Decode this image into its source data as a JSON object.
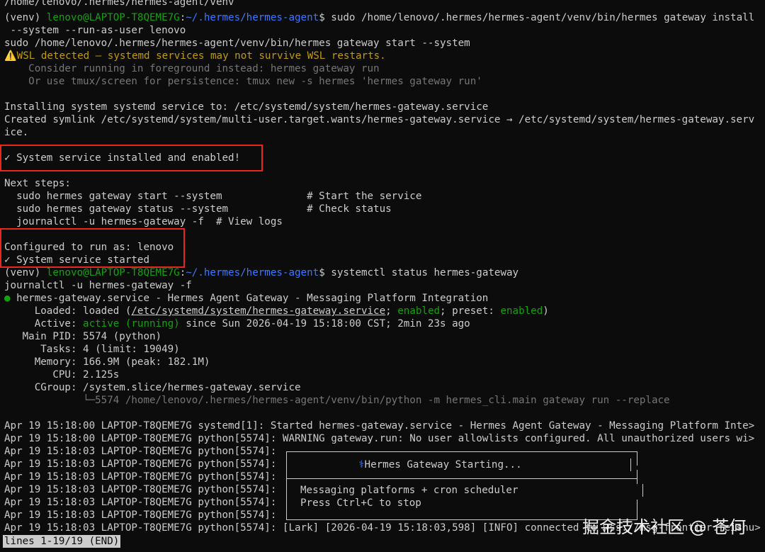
{
  "window": {
    "top_partial_line": "/home/lenovo/.hermes/hermes-agent/venv"
  },
  "prompt1": {
    "venv": "(venv) ",
    "userhost": "lenovo@LAPTOP-T8QEME7G",
    "sep": ":",
    "path": "~/.hermes/hermes-agent",
    "dollar": "$ ",
    "command": "sudo /home/lenovo/.hermes/hermes-agent/venv/bin/hermes gateway install",
    "command_wrap": " --system --run-as-user lenovo"
  },
  "install_output": {
    "sudo_echo": "sudo /home/lenovo/.hermes/hermes-agent/venv/bin/hermes gateway start --system",
    "wsl_warning_icon": "⚠️",
    "wsl_warning": "WSL detected — systemd services may not survive WSL restarts.",
    "hint1": "    Consider running in foreground instead: hermes gateway run",
    "hint2": "    Or use tmux/screen for persistence: tmux new -s hermes 'hermes gateway run'",
    "installing": "Installing system systemd service to: /etc/systemd/system/hermes-gateway.service",
    "symlink": "Created symlink /etc/systemd/system/multi-user.target.wants/hermes-gateway.service → /etc/systemd/system/hermes-gateway.serv",
    "symlink_wrap": "ice.",
    "installed": "✓ System service installed and enabled!",
    "next_steps": "Next steps:",
    "step1": "  sudo hermes gateway start --system              # Start the service",
    "step2": "  sudo hermes gateway status --system             # Check status",
    "step3": "  journalctl -u hermes-gateway -f  # View logs",
    "configured": "Configured to run as: lenovo",
    "started": "✓ System service started"
  },
  "prompt2": {
    "venv": "(venv) ",
    "userhost": "lenovo@LAPTOP-T8QEME7G",
    "sep": ":",
    "path": "~/.hermes/hermes-agent",
    "dollar": "$ ",
    "command": "systemctl status hermes-gateway",
    "command_line2": "journalctl -u hermes-gateway -f"
  },
  "status": {
    "dot": "●",
    "unit": " hermes-gateway.service - Hermes Agent Gateway - Messaging Platform Integration",
    "loaded_label": "     Loaded: ",
    "loaded_state": "loaded (",
    "loaded_path": "/etc/systemd/system/hermes-gateway.service",
    "loaded_sep": "; ",
    "enabled": "enabled",
    "preset_label": "; preset: ",
    "preset_val": "enabled",
    "loaded_end": ")",
    "active_label": "     Active: ",
    "active_val": "active (running)",
    "active_since": " since Sun 2026-04-19 15:18:00 CST; 2min 23s ago",
    "mainpid": "   Main PID: 5574 (python)",
    "tasks": "      Tasks: 4 (limit: 19049)",
    "memory": "     Memory: 166.9M (peak: 182.1M)",
    "cpu": "        CPU: 2.125s",
    "cgroup": "     CGroup: /system.slice/hermes-gateway.service",
    "cgroup_child": "             └─5574 /home/lenovo/.hermes/hermes-agent/venv/bin/python -m hermes_cli.main gateway run --replace"
  },
  "journal": {
    "lines": [
      "Apr 19 15:18:00 LAPTOP-T8QEME7G systemd[1]: Started hermes-gateway.service - Hermes Agent Gateway - Messaging Platform Inte>",
      "Apr 19 15:18:00 LAPTOP-T8QEME7G python[5574]: WARNING gateway.run: No user allowlists configured. All unauthorized users wi>",
      "Apr 19 15:18:03 LAPTOP-T8QEME7G python[5574]:",
      "Apr 19 15:18:03 LAPTOP-T8QEME7G python[5574]:",
      "Apr 19 15:18:03 LAPTOP-T8QEME7G python[5574]:",
      "Apr 19 15:18:03 LAPTOP-T8QEME7G python[5574]:",
      "Apr 19 15:18:03 LAPTOP-T8QEME7G python[5574]:",
      "Apr 19 15:18:03 LAPTOP-T8QEME7G python[5574]:",
      "Apr 19 15:18:03 LAPTOP-T8QEME7G python[5574]: [Lark] [2026-04-19 15:18:03,598] [INFO] connected to wss://msg-frontier.feishu>"
    ],
    "banner_title_icon": "⚕",
    "banner_title": "Hermes Gateway Starting...",
    "banner_line1": "Messaging platforms + cron scheduler",
    "banner_line2": "Press Ctrl+C to stop"
  },
  "pager": {
    "status": "lines 1-19/19 (END)"
  },
  "watermark": {
    "text": "掘金技术社区 @ 苍何"
  },
  "colors": {
    "background": "#0c0c0c",
    "foreground": "#cccccc",
    "green": "#13a10e",
    "blue": "#3b78ff",
    "yellow": "#c19c00",
    "highlight_box": "#e8271f"
  }
}
